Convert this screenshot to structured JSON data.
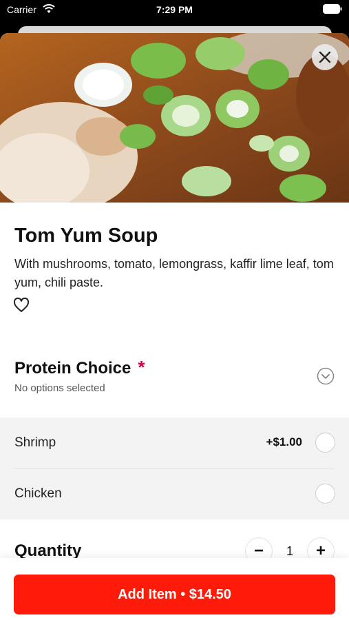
{
  "status_bar": {
    "carrier": "Carrier",
    "time": "7:29 PM"
  },
  "item": {
    "title": "Tom Yum Soup",
    "description": "With mushrooms, tomato, lemongrass, kaffir lime leaf, tom yum, chili paste."
  },
  "protein_choice": {
    "title": "Protein Choice",
    "required_mark": "*",
    "subtitle": "No options selected",
    "options": [
      {
        "name": "Shrimp",
        "price": "+$1.00"
      },
      {
        "name": "Chicken",
        "price": ""
      }
    ]
  },
  "quantity": {
    "label": "Quantity",
    "minus": "−",
    "value": "1",
    "plus": "+"
  },
  "add_button": {
    "label": "Add Item • $14.50"
  },
  "icons": [
    "wifi-icon",
    "battery-icon",
    "close-icon",
    "heart-icon",
    "chevron-down-circle-icon"
  ],
  "colors": {
    "accent": "#ff1a0a",
    "required": "#d1004a"
  }
}
